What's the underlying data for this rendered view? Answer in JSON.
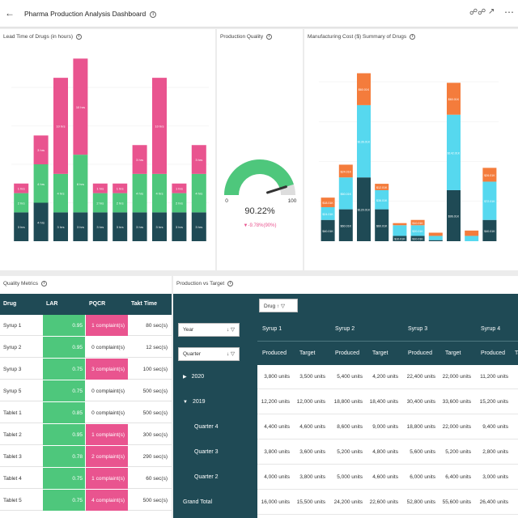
{
  "header": {
    "back_icon": "arrow-left-icon",
    "title": "Pharma Production Analysis Dashboard",
    "actions": [
      "binoculars-icon",
      "expand-icon",
      "more-icon"
    ]
  },
  "colors": {
    "teal_dark": "#1f4a55",
    "green": "#4ec77c",
    "pink": "#e9548f",
    "cyan": "#56d8ef",
    "orange": "#f47c3c",
    "gauge_rest": "#dddddd"
  },
  "lead_time": {
    "title": "Lead Time of Drugs (in hours)"
  },
  "production_quality": {
    "title": "Production Quality",
    "value": "90.22%",
    "delta": "▼-9.78%(90%)",
    "gauge_min": "0",
    "gauge_max": "100",
    "fraction": 0.9022
  },
  "manufacturing_cost": {
    "title": "Manufacturing Cost ($) Summary of Drugs"
  },
  "quality_metrics": {
    "title": "Quality Metrics",
    "columns": [
      "Drug",
      "LAR",
      "PQCR",
      "Takt Time"
    ],
    "rows": [
      {
        "drug": "Syrup 1",
        "lar": "0.95",
        "pqcr": "1 complaint(s)",
        "pink": true,
        "takt": "80 sec(s)"
      },
      {
        "drug": "Syrup 2",
        "lar": "0.95",
        "pqcr": "0 complaint(s)",
        "pink": false,
        "takt": "12 sec(s)"
      },
      {
        "drug": "Syrup 3",
        "lar": "0.75",
        "pqcr": "3 complaint(s)",
        "pink": true,
        "takt": "100 sec(s)"
      },
      {
        "drug": "Syrup 5",
        "lar": "0.75",
        "pqcr": "0 complaint(s)",
        "pink": false,
        "takt": "500 sec(s)"
      },
      {
        "drug": "Tablet 1",
        "lar": "0.85",
        "pqcr": "0 complaint(s)",
        "pink": false,
        "takt": "500 sec(s)"
      },
      {
        "drug": "Tablet 2",
        "lar": "0.95",
        "pqcr": "1 complaint(s)",
        "pink": true,
        "takt": "300 sec(s)"
      },
      {
        "drug": "Tablet 3",
        "lar": "0.78",
        "pqcr": "2 complaint(s)",
        "pink": true,
        "takt": "290 sec(s)"
      },
      {
        "drug": "Tablet 4",
        "lar": "0.75",
        "pqcr": "1 complaint(s)",
        "pink": true,
        "takt": "60 sec(s)"
      },
      {
        "drug": "Tablet 5",
        "lar": "0.75",
        "pqcr": "4 complaint(s)",
        "pink": true,
        "takt": "500 sec(s)"
      }
    ]
  },
  "production_vs_target": {
    "title": "Production vs Target",
    "drug_filter": "Drug",
    "year_filter": "Year",
    "quarter_filter": "Quarter",
    "drugs": [
      "Syrup 1",
      "Syrup 2",
      "Syrup 3",
      "Syrup 4"
    ],
    "col_produced": "Produced",
    "col_target": "Target",
    "cut_label": "Ta",
    "rows": [
      {
        "label": "2020",
        "expander": "▶",
        "values": [
          "3,800 units",
          "3,500 units",
          "5,400 units",
          "4,200 units",
          "22,400 units",
          "22,000 units",
          "11,200 units"
        ]
      },
      {
        "label": "2019",
        "expander": "▼",
        "values": [
          "12,200 units",
          "12,000 units",
          "18,800 units",
          "18,400 units",
          "30,400 units",
          "33,600 units",
          "15,200 units"
        ]
      },
      {
        "label": "Quarter 4",
        "expander": "",
        "values": [
          "4,400 units",
          "4,600 units",
          "8,600 units",
          "9,000 units",
          "18,800 units",
          "22,000 units",
          "9,400 units"
        ]
      },
      {
        "label": "Quarter 3",
        "expander": "",
        "values": [
          "3,800 units",
          "3,600 units",
          "5,200 units",
          "4,800 units",
          "5,600 units",
          "5,200 units",
          "2,800 units"
        ]
      },
      {
        "label": "Quarter 2",
        "expander": "",
        "values": [
          "4,000 units",
          "3,800 units",
          "5,000 units",
          "4,600 units",
          "6,000 units",
          "6,400 units",
          "3,000 units"
        ]
      },
      {
        "label": "Grand Total",
        "expander": "",
        "values": [
          "16,000 units",
          "15,500 units",
          "24,200 units",
          "22,600 units",
          "52,800 units",
          "55,600 units",
          "26,400 units"
        ]
      }
    ]
  },
  "chart_data": [
    {
      "type": "bar",
      "stacked": true,
      "title": "Lead Time of Drugs (in hours)",
      "series": [
        {
          "name": "",
          "color": "#1f4a55",
          "values": [
            3,
            4,
            3,
            3,
            3,
            3,
            3,
            3,
            3,
            3
          ]
        },
        {
          "name": "",
          "color": "#4ec77c",
          "values": [
            2,
            4,
            4,
            6,
            2,
            2,
            4,
            4,
            2,
            4
          ]
        },
        {
          "name": "",
          "color": "#e9548f",
          "values": [
            1,
            3,
            10,
            10,
            1,
            1,
            3,
            10,
            1,
            3
          ]
        }
      ],
      "labels": [
        [
          "3 hrs",
          "4 hrs",
          "3 hrs",
          "3 hrs",
          "3 hrs",
          "3 hrs",
          "3 hrs",
          "3 hrs",
          "3 hrs",
          "3 hrs"
        ],
        [
          "2 hrs",
          "4 hrs",
          "4 hrs",
          "6 hrs",
          "2 hrs",
          "2 hrs",
          "4 hrs",
          "4 hrs",
          "2 hrs",
          "4 hrs"
        ],
        [
          "1 hrs",
          "3 hrs",
          "10 hrs",
          "10 hrs",
          "1 hrs",
          "1 hrs",
          "3 hrs",
          "10 hrs",
          "1 hrs",
          "3 hrs"
        ]
      ],
      "ylim": [
        0,
        16
      ]
    },
    {
      "type": "bar",
      "stacked": true,
      "title": "Manufacturing Cost ($) Summary of Drugs",
      "series": [
        {
          "name": "",
          "color": "#1f4a55",
          "values": [
            40,
            60,
            120,
            60,
            10,
            10,
            2,
            96,
            0,
            40
          ]
        },
        {
          "name": "",
          "color": "#56d8ef",
          "values": [
            24,
            60,
            136,
            36,
            20,
            20,
            8,
            142,
            10,
            72
          ]
        },
        {
          "name": "",
          "color": "#f47c3c",
          "values": [
            18,
            24,
            60,
            12,
            4,
            10,
            6,
            60,
            10,
            26
          ]
        }
      ],
      "labels": [
        [
          "$40.01K",
          "$60.01K",
          "$120.01K",
          "$60.01K",
          "$10.01K",
          "$10.01K",
          "",
          "$96.01K",
          "",
          "$40.01K"
        ],
        [
          "$24.01K",
          "$60.01K",
          "$136.01K",
          "$36.01K",
          "",
          "$20.01K",
          "",
          "$142.01K",
          "",
          "$72.01K"
        ],
        [
          "$18.01K",
          "$24.01K",
          "$60.01K",
          "$12.01K",
          "",
          "$10.01K",
          "",
          "$60.01K",
          "",
          "$26.01K"
        ]
      ],
      "ylim": [
        0,
        300
      ]
    }
  ]
}
